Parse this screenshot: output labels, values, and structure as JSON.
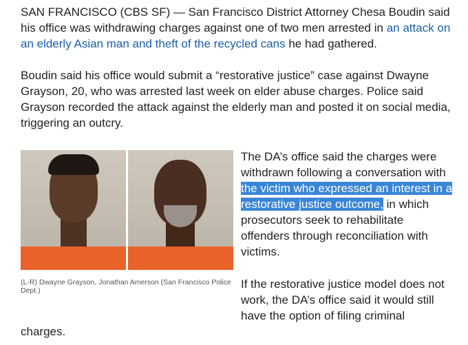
{
  "article": {
    "p1_part1": "SAN FRANCISCO (CBS SF) — San Francisco District Attorney Chesa Boudin said his office was withdrawing charges against one of two men arrested in ",
    "p1_link": "an attack on an elderly Asian man and theft of the recycled cans",
    "p1_part2": " he had gathered.",
    "p2": "Boudin said his office would submit a “restorative justice” case against Dwayne Grayson, 20, who was arrested last week on elder abuse charges. Police said Grayson recorded the attack against the elderly man and posted it on social media, triggering an outcry.",
    "p3_part1": "The DA’s office said the charges were withdrawn following a conversation with ",
    "p3_highlight": "the victim who expressed an interest in a restorative justice outcome,",
    "p3_part2": " in which prosecutors seek to rehabilitate offenders through reconciliation with victims.",
    "p4_part1": "If the restorative justice model does not work, the DA’s office said it would still have the option of filing criminal",
    "p4_part2": "charges.",
    "caption": "(L-R) Dwayne Grayson, Jonathan Amerson (San Francisco Police Dept.)"
  },
  "colors": {
    "link": "#1a5fa8",
    "selection": "#3a86d6"
  }
}
